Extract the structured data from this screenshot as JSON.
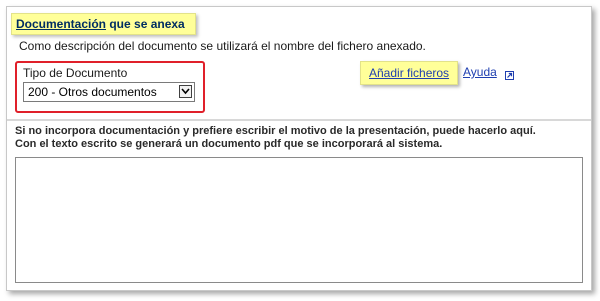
{
  "section": {
    "title_prefix": "Documentación",
    "title_rest": " que se anexa",
    "description": "Como descripción del documento se utilizará el nombre del fichero anexado."
  },
  "document_type": {
    "label": "Tipo de Documento",
    "selected": "200 - Otros documentos",
    "highlight_color": "#e0202a"
  },
  "actions": {
    "add_files_label": "Añadir ficheros",
    "help_label": "Ayuda"
  },
  "free_text": {
    "instruction_line1": "Si no incorpora documentación y prefiere escribir el motivo de la presentación, puede hacerlo aquí.",
    "instruction_line2": "Con el texto escrito se generará un documento pdf que se incorporará al sistema.",
    "value": ""
  },
  "icons": {
    "select_arrow": "chevron-down-icon",
    "help": "external-link-icon"
  },
  "colors": {
    "title_bg": "#ffff99",
    "title_text": "#002d62",
    "link": "#1f3fb0"
  }
}
